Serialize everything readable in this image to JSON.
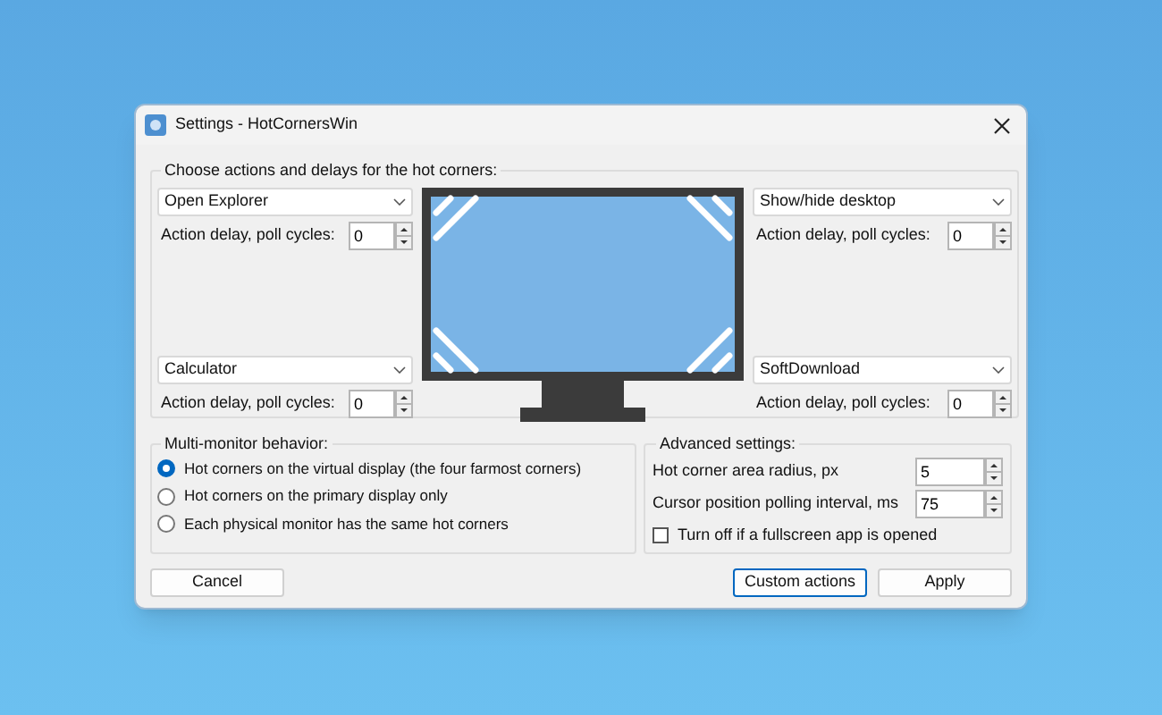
{
  "window": {
    "title": "Settings - HotCornersWin"
  },
  "corners_group": {
    "title": "Choose actions and delays for the hot corners:",
    "corners": [
      {
        "action": "Open Explorer",
        "delay_label": "Action delay, poll cycles:",
        "delay": "0"
      },
      {
        "action": "Show/hide desktop",
        "delay_label": "Action delay, poll cycles:",
        "delay": "0"
      },
      {
        "action": "Calculator",
        "delay_label": "Action delay, poll cycles:",
        "delay": "0"
      },
      {
        "action": "SoftDownload",
        "delay_label": "Action delay, poll cycles:",
        "delay": "0"
      }
    ]
  },
  "multi_monitor": {
    "title": "Multi-monitor behavior:",
    "options": [
      {
        "label": "Hot corners on the virtual display (the four farmost corners)",
        "selected": true
      },
      {
        "label": "Hot corners on the primary display only",
        "selected": false
      },
      {
        "label": "Each physical monitor has the same hot corners",
        "selected": false
      }
    ]
  },
  "advanced": {
    "title": "Advanced settings:",
    "radius_label": "Hot corner area radius, px",
    "radius": "5",
    "polling_label": "Cursor position polling interval, ms",
    "polling": "75",
    "fullscreen": {
      "label": "Turn off if a fullscreen app is opened",
      "checked": false
    }
  },
  "buttons": [
    {
      "label": "Cancel",
      "kind": "plain"
    },
    {
      "label": "Custom actions",
      "kind": "focused"
    },
    {
      "label": "Apply",
      "kind": "plain"
    }
  ]
}
